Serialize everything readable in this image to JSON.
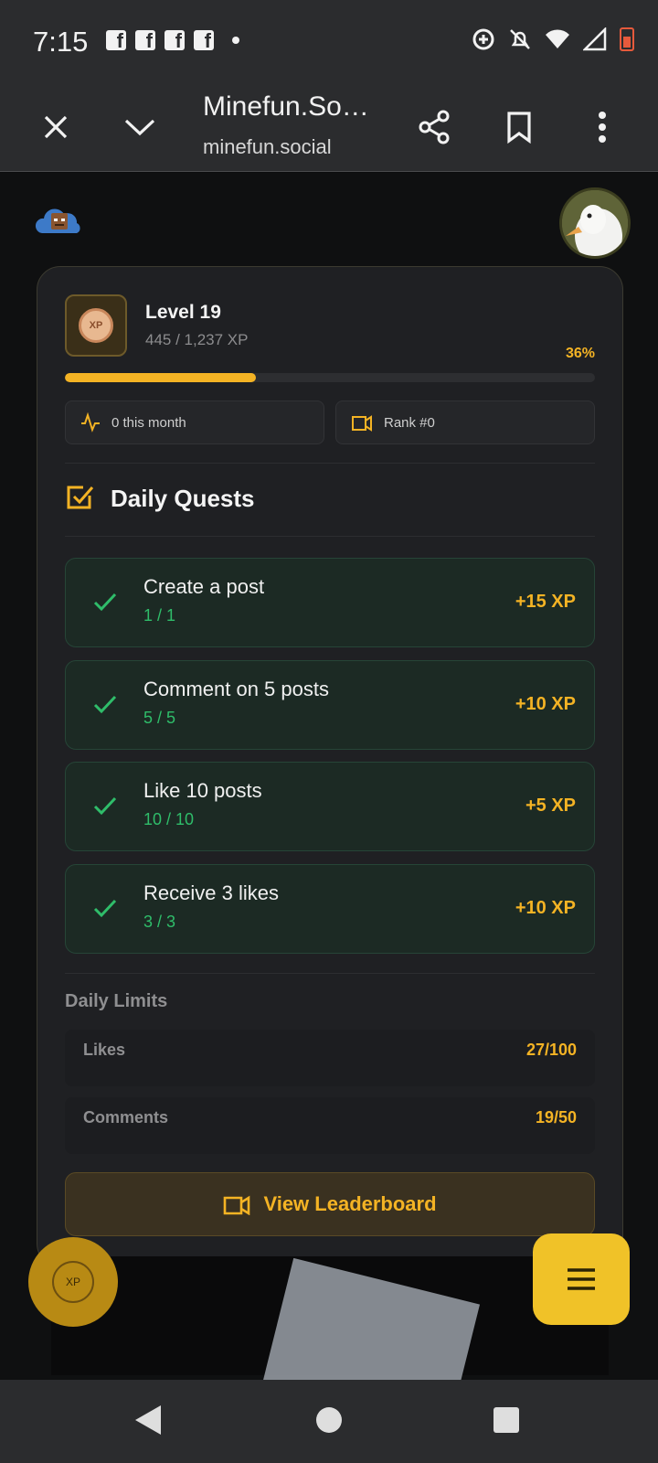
{
  "status_bar": {
    "time": "7:15"
  },
  "browser": {
    "title": "Minefun.So…",
    "url": "minefun.social",
    "icons": [
      "close-icon",
      "chevron-down-icon",
      "share-icon",
      "bookmark-icon",
      "more-vert-icon"
    ]
  },
  "level": {
    "title": "Level 19",
    "xp_text": "445 / 1,237 XP",
    "percent_text": "36%",
    "progress_fraction": 0.36,
    "badge_text": "XP"
  },
  "stats": {
    "month": "0 this month",
    "rank": "Rank #0"
  },
  "daily_quests": {
    "title": "Daily Quests",
    "items": [
      {
        "name": "Create a post",
        "progress": "1 / 1",
        "reward": "+15 XP"
      },
      {
        "name": "Comment on 5 posts",
        "progress": "5 / 5",
        "reward": "+10 XP"
      },
      {
        "name": "Like 10 posts",
        "progress": "10 / 10",
        "reward": "+5 XP"
      },
      {
        "name": "Receive 3 likes",
        "progress": "3 / 3",
        "reward": "+10 XP"
      }
    ]
  },
  "daily_limits": {
    "title": "Daily Limits",
    "likes_label": "Likes",
    "likes_value": "27/100",
    "comments_label": "Comments",
    "comments_value": "19/50"
  },
  "leaderboard_button": "View Leaderboard",
  "fab_badge_text": "XP",
  "colors": {
    "accent": "#f4b324",
    "success": "#2fbd6a",
    "card_bg": "#1f2023"
  }
}
